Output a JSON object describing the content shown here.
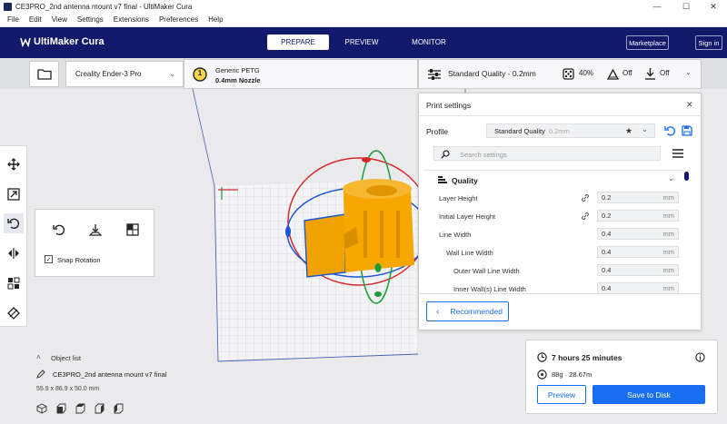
{
  "window": {
    "title": "CE3PRO_2nd antenna mount v7 final - UltiMaker Cura",
    "minimize": "—",
    "maximize": "☐",
    "close": "✕"
  },
  "menu": [
    "File",
    "Edit",
    "View",
    "Settings",
    "Extensions",
    "Preferences",
    "Help"
  ],
  "header": {
    "logo": "UltiMaker Cura",
    "tabs": [
      "PREPARE",
      "PREVIEW",
      "MONITOR"
    ],
    "marketplace": "Marketplace",
    "sign_in": "Sign in"
  },
  "printer": {
    "name": "Creality Ender-3 Pro"
  },
  "material": {
    "badge": "1",
    "name": "Generic PETG",
    "nozzle": "0.4mm Nozzle"
  },
  "quality_bar": {
    "profile": "Standard Quality - 0.2mm",
    "infill": "40%",
    "support": "Off",
    "adhesion": "Off"
  },
  "rotate_panel": {
    "snap_label": "Snap Rotation",
    "snap_checked": true
  },
  "object_list": {
    "header": "Object list",
    "name": "CE3PRO_2nd antenna mount v7 final",
    "dims": "55.9 x 86.9 x 50.0 mm"
  },
  "print_settings": {
    "title": "Print settings",
    "profile_label": "Profile",
    "profile_value": "Standard Quality",
    "profile_suffix": "0.2mm",
    "search_placeholder": "Search settings",
    "section": "Quality",
    "rows": [
      {
        "label": "Layer Height",
        "value": "0.2",
        "unit": "mm",
        "linked": true
      },
      {
        "label": "Initial Layer Height",
        "value": "0.2",
        "unit": "mm",
        "linked": true
      },
      {
        "label": "Line Width",
        "value": "0.4",
        "unit": "mm",
        "linked": false
      },
      {
        "label": "Wall Line Width",
        "value": "0.4",
        "unit": "mm",
        "linked": false
      },
      {
        "label": "Outer Wall Line Width",
        "value": "0.4",
        "unit": "mm",
        "linked": false
      },
      {
        "label": "Inner Wall(s) Line Width",
        "value": "0.4",
        "unit": "mm",
        "linked": false
      }
    ],
    "recommended": "Recommended"
  },
  "output": {
    "time": "7 hours 25 minutes",
    "material": "88g · 28.67m",
    "preview": "Preview",
    "save": "Save to Disk"
  },
  "colors": {
    "header": "#12196b",
    "accent": "#196ef0",
    "model": "#f8a600",
    "ring_red": "#d8262b",
    "ring_blue": "#1a55d4",
    "ring_green": "#1a9e3b"
  }
}
